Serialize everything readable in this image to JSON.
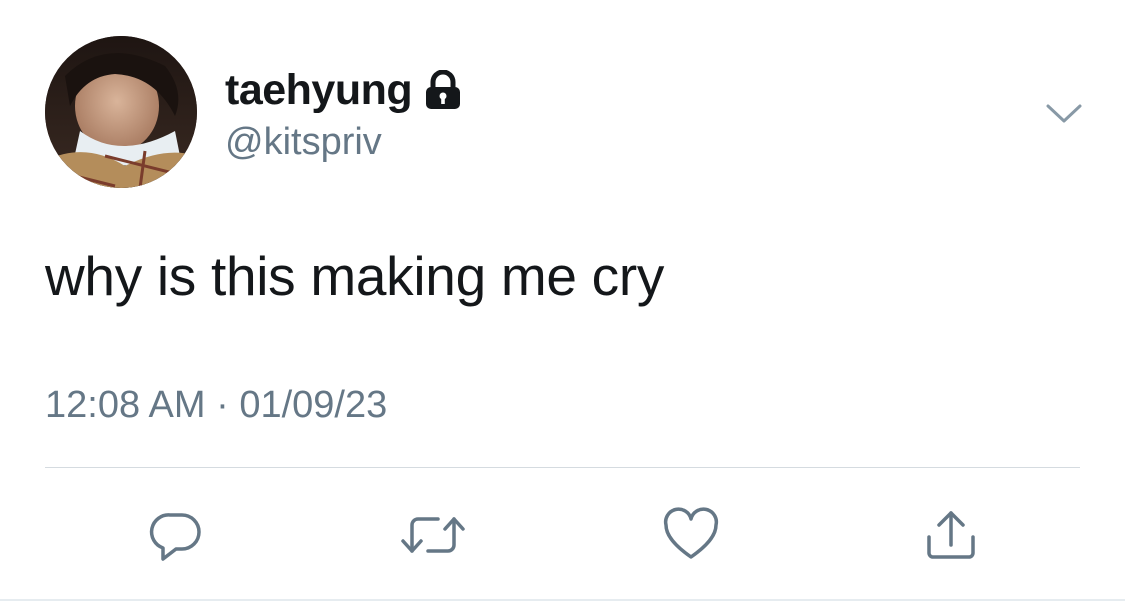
{
  "tweet": {
    "display_name": "taehyung",
    "handle": "@kitspriv",
    "text": "why is this making me cry",
    "timestamp": "12:08 AM · 01/09/23"
  },
  "icons": {
    "protected": "lock-icon",
    "menu": "chevron-down-icon",
    "reply": "reply-icon",
    "retweet": "retweet-icon",
    "like": "heart-icon",
    "share": "share-icon"
  },
  "colors": {
    "text": "#14171a",
    "secondary": "#657786",
    "icon": "#657786",
    "divider": "#d5dbe0"
  }
}
